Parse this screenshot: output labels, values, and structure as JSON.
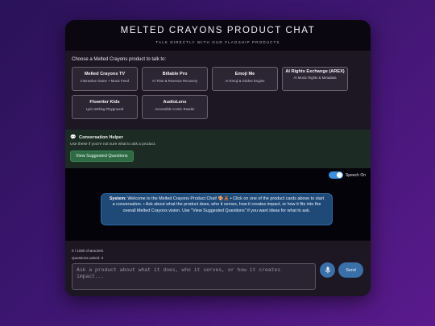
{
  "header": {
    "title": "MELTED CRAYONS PRODUCT CHAT",
    "subtitle": "TALK DIRECTLY WITH OUR FLAGSHIP PRODUCTS"
  },
  "products": {
    "prompt": "Choose a Melted Crayons product to talk to:",
    "items": [
      {
        "name": "Melted Crayons TV",
        "desc": "Interactive Game + Music Feed"
      },
      {
        "name": "Billable Pro",
        "desc": "AI Time & Revenue Recovery"
      },
      {
        "name": "Emoji Me",
        "desc": "AI Emoji & Sticker Engine"
      },
      {
        "name": "AI Rights Exchange (AREX)",
        "desc": "AI Music Rights & Metadata"
      },
      {
        "name": "Flowriter Kids",
        "desc": "Lyric-Writing Playground"
      },
      {
        "name": "AudioLens",
        "desc": "Accessible Comic Reader"
      }
    ]
  },
  "helper": {
    "icon": "speech-bubble-icon",
    "title": "Conversation Helper",
    "hint": "Use these if you're not sure what to ask a product.",
    "button_label": "View Suggested Questions"
  },
  "chat": {
    "speech_label": "Speech On",
    "speech_on": true,
    "message_sender": "System:",
    "message_text": "Welcome to the Melted Crayons Product Chat! 🎨🧸 • Click on one of the product cards above to start a conversation. • Ask about what the product does, who it serves, how it creates impact, or how it fits into the overall Melted Crayons vision. Use \"View Suggested Questions\" if you want ideas for what to ask."
  },
  "composer": {
    "char_count": "0 / 1500 characters",
    "questions_asked": "Questions asked: 0",
    "placeholder": "Ask a product about what it does, who it serves, or how it creates impact...",
    "send_label": "Send"
  },
  "colors": {
    "accent": "#3a6fa8",
    "helper_button": "#2e6b44",
    "toggle_on": "#3d8fe0"
  }
}
